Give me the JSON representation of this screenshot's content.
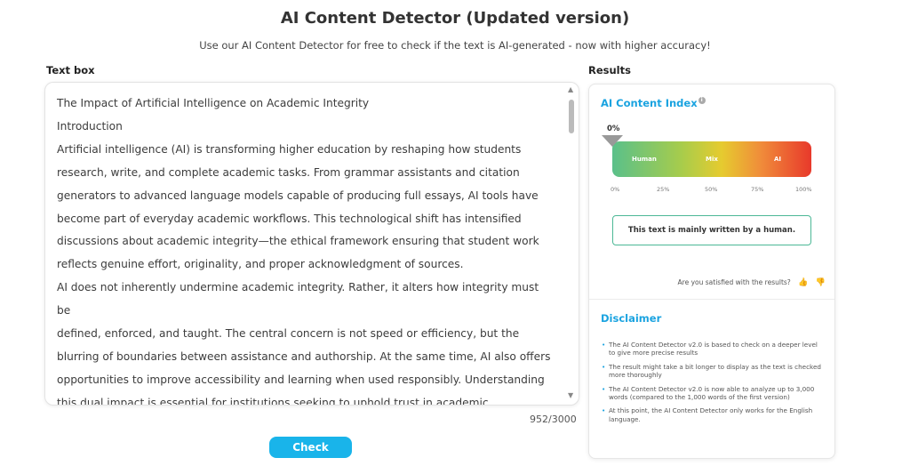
{
  "header": {
    "title": "AI Content Detector (Updated version)",
    "subtitle": "Use our AI Content Detector for free to check if the text is AI-generated - now with higher accuracy!"
  },
  "textbox": {
    "label": "Text box",
    "lines": [
      "The Impact of Artificial Intelligence on Academic Integrity",
      "Introduction",
      "Artificial intelligence (AI) is transforming higher education by reshaping how students",
      "research, write, and complete academic tasks. From grammar assistants and citation",
      "generators to advanced language models capable of producing full essays, AI tools have",
      "become part of everyday academic workflows. This technological shift has intensified",
      "discussions about academic integrity—the ethical framework ensuring that student work",
      "reflects genuine effort, originality, and proper acknowledgment of sources.",
      "AI does not inherently undermine academic integrity. Rather, it alters how integrity must be",
      "defined, enforced, and taught. The central concern is not speed or efficiency, but the",
      "blurring of boundaries between assistance and authorship. At the same time, AI also offers",
      "opportunities to improve accessibility and learning when used responsibly. Understanding",
      "this dual impact is essential for institutions seeking to uphold trust in academic credentials."
    ],
    "word_count": "952/3000",
    "check_label": "Check",
    "scroll_up_icon": "triangle-up",
    "scroll_down_icon": "triangle-down"
  },
  "results": {
    "label": "Results",
    "index_title": "AI Content Index",
    "info_icon": "i",
    "score": "0%",
    "score_value": 0,
    "zones": {
      "human": "Human",
      "mix": "Mix",
      "ai": "AI"
    },
    "ticks": [
      "0%",
      "25%",
      "50%",
      "75%",
      "100%"
    ],
    "verdict": "This text is mainly written by a human.",
    "feedback_question": "Are you satisfied with the results?",
    "thumbs_up_icon": "👍",
    "thumbs_down_icon": "👎",
    "disclaimer_title": "Disclaimer",
    "disclaimer_items": [
      "The AI Content Detector v2.0 is based to check on a deeper level to give more precise results",
      "The result might take a bit longer to display as the text is checked more thoroughly",
      "The AI Content Detector v2.0 is now able to analyze up to 3,000 words (compared to the 1,000 words of the first version)",
      "At this point, the AI Content Detector only works for the English language."
    ],
    "colors": {
      "accent": "#1aa3e0",
      "human": "#5ac08a",
      "mix": "#e6cb2f",
      "ai": "#e8392b",
      "verdict_border": "#4cb896"
    }
  }
}
